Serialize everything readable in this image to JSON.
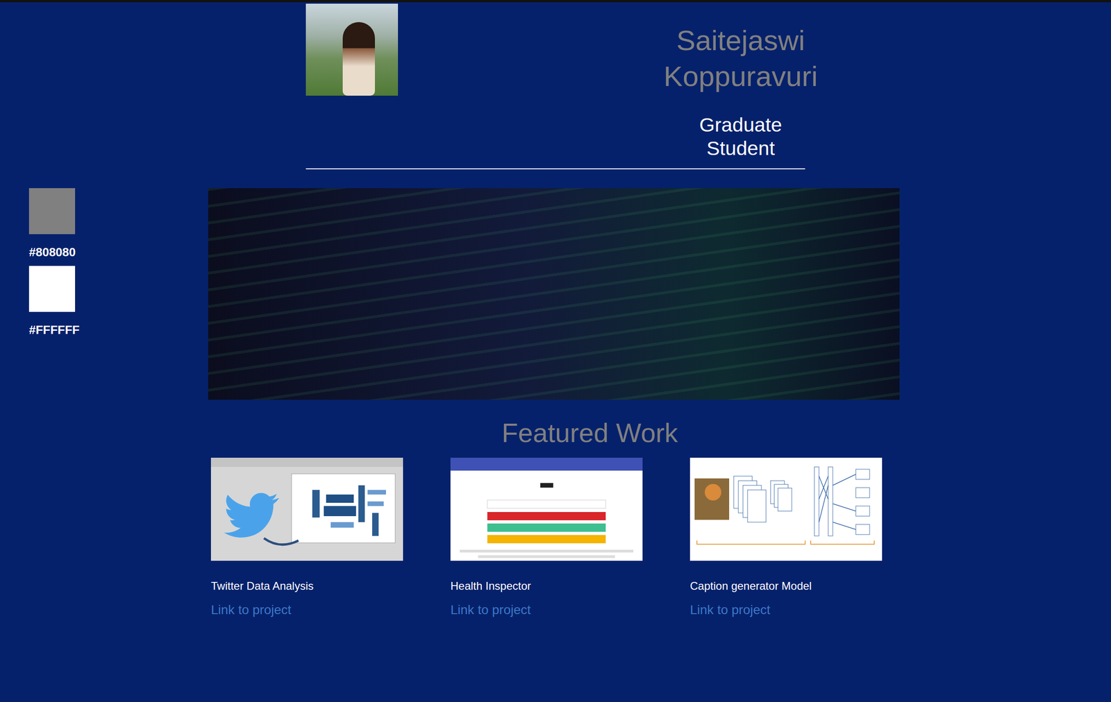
{
  "profile": {
    "name": "Saitejaswi Koppuravuri",
    "role": "Graduate Student"
  },
  "swatches": [
    {
      "label": "#808080",
      "color": "#808080"
    },
    {
      "label": "#FFFFFF",
      "color": "#FFFFFF"
    }
  ],
  "featured": {
    "title": "Featured Work",
    "projects": [
      {
        "title": "Twitter Data Analysis",
        "link": "Link to project",
        "kind": "twitter"
      },
      {
        "title": "Health Inspector",
        "link": "Link to project",
        "kind": "app"
      },
      {
        "title": "Caption generator Model",
        "link": "Link to project",
        "kind": "diagram"
      }
    ]
  }
}
